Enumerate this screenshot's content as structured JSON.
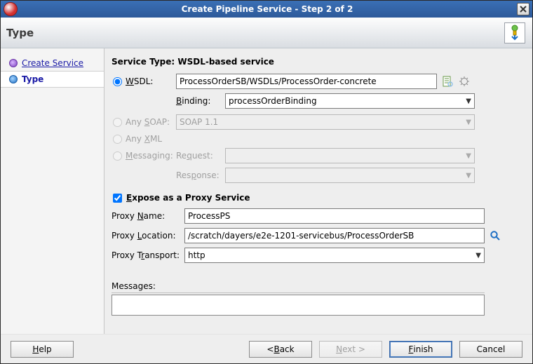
{
  "titlebar": {
    "title": "Create Pipeline Service - Step 2 of 2"
  },
  "header": {
    "title": "Type"
  },
  "sidebar": {
    "step1": {
      "label": "Create Service"
    },
    "step2": {
      "label": "Type"
    }
  },
  "section": {
    "service_type_label": "Service Type: WSDL-based service",
    "radios": {
      "wsdl": "WSDL:",
      "any_soap": "Any SOAP:",
      "any_xml": "Any XML",
      "messaging": "Messaging:"
    },
    "wsdl_path": "ProcessOrderSB/WSDLs/ProcessOrder-concrete",
    "binding_label": "Binding:",
    "binding_value": "processOrderBinding",
    "soap_value": "SOAP 1.1",
    "request_label": "Request:",
    "response_label": "Response:",
    "expose_label": "Expose as a Proxy Service",
    "proxy_name_label": "Proxy Name:",
    "proxy_name_value": "ProcessPS",
    "proxy_location_label": "Proxy Location:",
    "proxy_location_value": "/scratch/dayers/e2e-1201-servicebus/ProcessOrderSB",
    "proxy_transport_label": "Proxy Transport:",
    "proxy_transport_value": "http",
    "messages_label": "Messages:"
  },
  "footer": {
    "help": "Help",
    "back": "< Back",
    "next": "Next >",
    "finish": "Finish",
    "cancel": "Cancel"
  }
}
